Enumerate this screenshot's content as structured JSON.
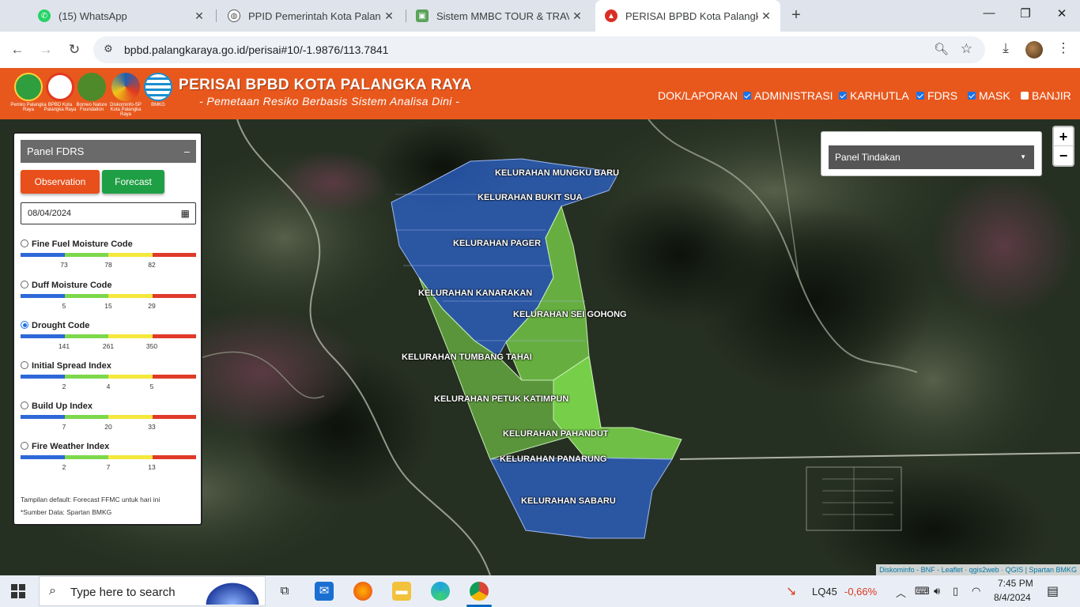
{
  "browser": {
    "tabs": [
      {
        "title": "(15) WhatsApp",
        "icon": "whatsapp-icon",
        "active": false
      },
      {
        "title": "PPID Pemerintah Kota Palangka",
        "icon": "globe-icon",
        "active": false
      },
      {
        "title": "Sistem MMBC TOUR & TRAVEL",
        "icon": "app-icon",
        "active": false
      },
      {
        "title": "PERISAI BPBD Kota Palangka Ra",
        "icon": "bpbd-icon",
        "active": true
      }
    ],
    "new_tab": "+",
    "url": "bpbd.palangkaraya.go.id/perisai#10/-1.9876/113.7841"
  },
  "header": {
    "title": "PERISAI BPBD KOTA PALANGKA RAYA",
    "subtitle": "- Pemetaan Resiko Berbasis Sistem Analisa Dini -",
    "logos": [
      {
        "caption": "Pemko Palangka Raya",
        "color": "#2f9e3f"
      },
      {
        "caption": "BPBD Kota Palangka Raya",
        "color": "#e23a1e"
      },
      {
        "caption": "Borneo Nature Foundation",
        "color": "#4e8a2a"
      },
      {
        "caption": "Diskominfo-SP Kota Palangka Raya",
        "color": "#1f5fb3"
      },
      {
        "caption": "BMKG",
        "color": "#1a8fcf"
      }
    ],
    "nav": {
      "doc": "DOK/LAPORAN",
      "layers": [
        {
          "label": "ADMINISTRASI",
          "checked": true
        },
        {
          "label": "KARHUTLA",
          "checked": true
        },
        {
          "label": "FDRS",
          "checked": true
        },
        {
          "label": "MASK",
          "checked": true
        },
        {
          "label": "BANJIR",
          "checked": false
        }
      ]
    }
  },
  "panel_fdrs": {
    "title": "Panel FDRS",
    "collapse": "–",
    "btn_observation": "Observation",
    "btn_forecast": "Forecast",
    "date": "08/04/2024",
    "scale_colors": [
      "#2e68d8",
      "#7dd84c",
      "#f5e83c",
      "#e03a2a"
    ],
    "indices": [
      {
        "name": "Fine Fuel Moisture Code",
        "ticks": [
          "73",
          "78",
          "82"
        ],
        "selected": false
      },
      {
        "name": "Duff Moisture Code",
        "ticks": [
          "5",
          "15",
          "29"
        ],
        "selected": false
      },
      {
        "name": "Drought Code",
        "ticks": [
          "141",
          "261",
          "350"
        ],
        "selected": true
      },
      {
        "name": "Initial Spread Index",
        "ticks": [
          "2",
          "4",
          "5"
        ],
        "selected": false
      },
      {
        "name": "Build Up Index",
        "ticks": [
          "7",
          "20",
          "33"
        ],
        "selected": false
      },
      {
        "name": "Fire Weather Index",
        "ticks": [
          "2",
          "7",
          "13"
        ],
        "selected": false
      }
    ],
    "note_default": "Tampilan default: Forecast FFMC untuk hari ini",
    "note_source": "*Sumber Data: Spartan BMKG"
  },
  "panel_tindakan": {
    "label": "Panel Tindakan"
  },
  "map": {
    "zoom_in": "+",
    "zoom_out": "−",
    "attribution": "Diskominfo - BNF - Leaflet · qgis2web · QGIS | Spartan BMKG",
    "kelurahan": [
      "KELURAHAN MUNGKU BARU",
      "KELURAHAN BUKIT SUA",
      "KELURAHAN PAGER",
      "KELURAHAN KANARAKAN",
      "KELURAHAN SEI GOHONG",
      "KELURAHAN TUMBANG TAHAI",
      "KELURAHAN PETUK KATIMPUN",
      "KELURAHAN PAHANDUT",
      "KELURAHAN PANARUNG",
      "KELURAHAN SABARU"
    ]
  },
  "taskbar": {
    "search_placeholder": "Type here to search",
    "stock_name": "LQ45",
    "stock_change": "-0,66%",
    "time": "7:45 PM",
    "date": "8/4/2024"
  }
}
